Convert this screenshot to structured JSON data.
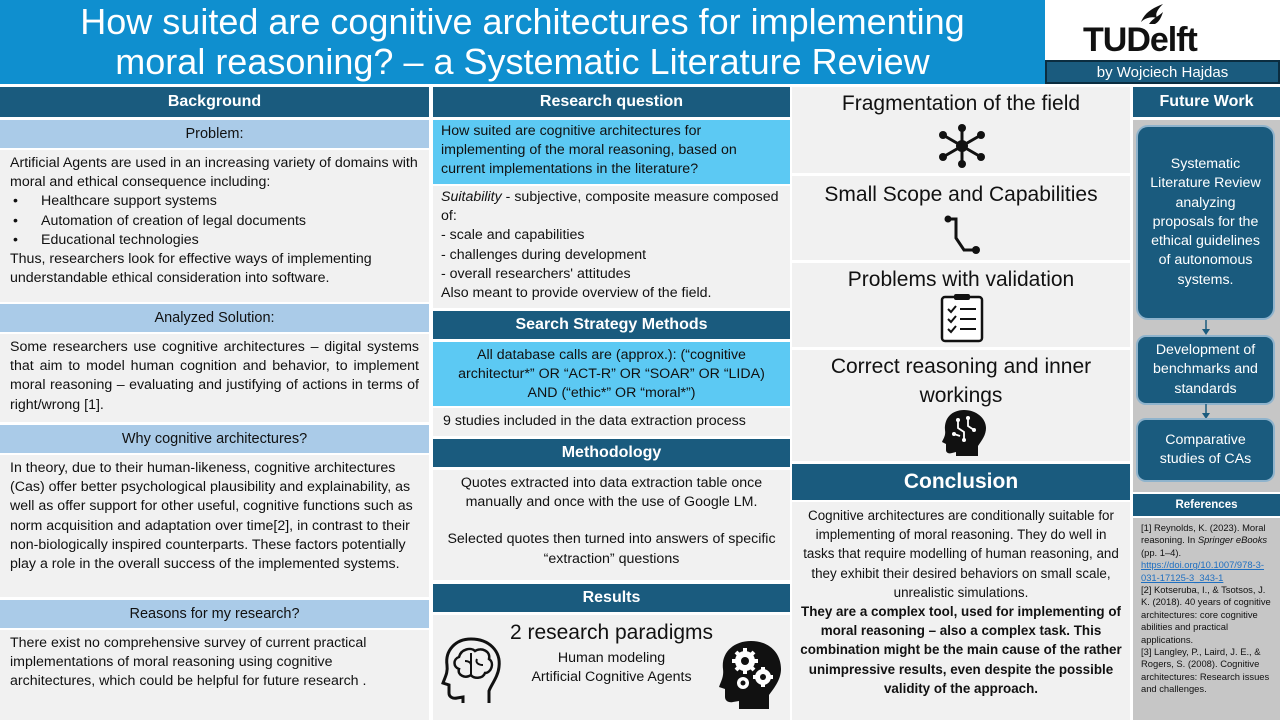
{
  "title": {
    "line1": "How suited are cognitive architectures for implementing",
    "line2": "moral reasoning? – a Systematic Literature Review",
    "logo_text": "TUDelft",
    "author": "by Wojciech Hajdas"
  },
  "background": {
    "header": "Background",
    "problem_header": "Problem:",
    "problem_intro": "Artificial Agents are used in an increasing variety of domains with moral and ethical consequence including:",
    "problem_items": [
      "Healthcare support systems",
      "Automation of creation of legal documents",
      "Educational technologies"
    ],
    "problem_outro": "Thus, researchers look for effective ways of implementing understandable ethical consideration into software.",
    "solution_header": "Analyzed Solution:",
    "solution_text": "Some researchers use cognitive architectures – digital systems that aim to model human cognition and behavior, to implement moral reasoning – evaluating and justifying of actions in terms of right/wrong [1].",
    "why_header": "Why cognitive architectures?",
    "why_text": "In theory, due to their human-likeness, cognitive architectures (Cas) offer better psychological plausibility and explainability, as well as offer support for other useful, cognitive functions such as norm acquisition and adaptation over time[2], in contrast to their non-biologically inspired counterparts. These factors potentially play a role in the overall success of the implemented systems.",
    "reasons_header": "Reasons for my research?",
    "reasons_text": "There exist no comprehensive survey of current practical implementations of moral reasoning using cognitive architectures, which could be helpful for future research ."
  },
  "research": {
    "header": "Research question",
    "question": "How suited are cognitive architectures for implementing of the moral reasoning, based on current implementations in the literature?",
    "suit_term": "Suitability",
    "suit_def": " - subjective, composite measure composed of:",
    "suit_items": [
      "- scale and capabilities",
      "- challenges during development",
      "- overall researchers' attitudes"
    ],
    "suit_outro": "Also meant to provide overview of the field."
  },
  "search": {
    "header": "Search Strategy Methods",
    "query": "All database calls are (approx.): (“cognitive architectur*” OR “ACT-R” OR “SOAR” OR “LIDA) AND (“ethic*” OR “moral*”)",
    "studies": "9 studies included in the data extraction process"
  },
  "methodology": {
    "header": "Methodology",
    "para1": "Quotes extracted into data extraction table once manually and once with the use of Google LM.",
    "para2": "Selected quotes then turned into answers of specific “extraction” questions"
  },
  "results": {
    "header": "Results",
    "big": "2 research paradigms",
    "line1": "Human modeling",
    "line2": "Artificial Cognitive Agents"
  },
  "findings": [
    {
      "title": "Fragmentation of the field",
      "icon": "network-hub-icon"
    },
    {
      "title": "Small Scope and Capabilities",
      "icon": "path-steps-icon"
    },
    {
      "title": "Problems with validation",
      "icon": "checklist-icon"
    },
    {
      "title": "Correct reasoning and inner workings",
      "icon": "ai-head-icon"
    }
  ],
  "conclusion": {
    "header": "Conclusion",
    "normal": "Cognitive architectures are conditionally suitable for implementing of moral reasoning. They do well in tasks that require modelling of human reasoning, and they exhibit their desired behaviors on small scale, unrealistic simulations.",
    "bold": "They are a complex tool, used for implementing of moral reasoning – also a complex task. This combination might be the main cause of the rather unimpressive results, even despite the possible validity of the approach."
  },
  "future": {
    "header": "Future Work",
    "item1": "Systematic Literature Review analyzing proposals for the ethical guidelines of autonomous systems.",
    "item2": "Development of benchmarks and standards",
    "item3": "Comparative studies of CAs"
  },
  "references": {
    "header": "References",
    "ref1_a": "[1]  Reynolds, K. (2023). Moral reasoning. In ",
    "ref1_i": "Springer eBooks",
    "ref1_b": " (pp. 1–4). ",
    "ref1_link": "https://doi.org/10.1007/978-3-031-17125-3_343-1",
    "ref2": "[2] Kotseruba, I., & Tsotsos, J. K. (2018). 40 years of cognitive architectures: core cognitive abilities and practical applications.",
    "ref3": "[3] Langley, P., Laird, J. E., & Rogers, S. (2008). Cognitive architectures: Research issues and challenges."
  },
  "colors": {
    "title_bg": "#0f8fcf",
    "dark_header": "#1a5b7e",
    "light_header": "#aacbe8",
    "cyan_box": "#5cc9f3",
    "gray_box": "#f1f1f1"
  }
}
